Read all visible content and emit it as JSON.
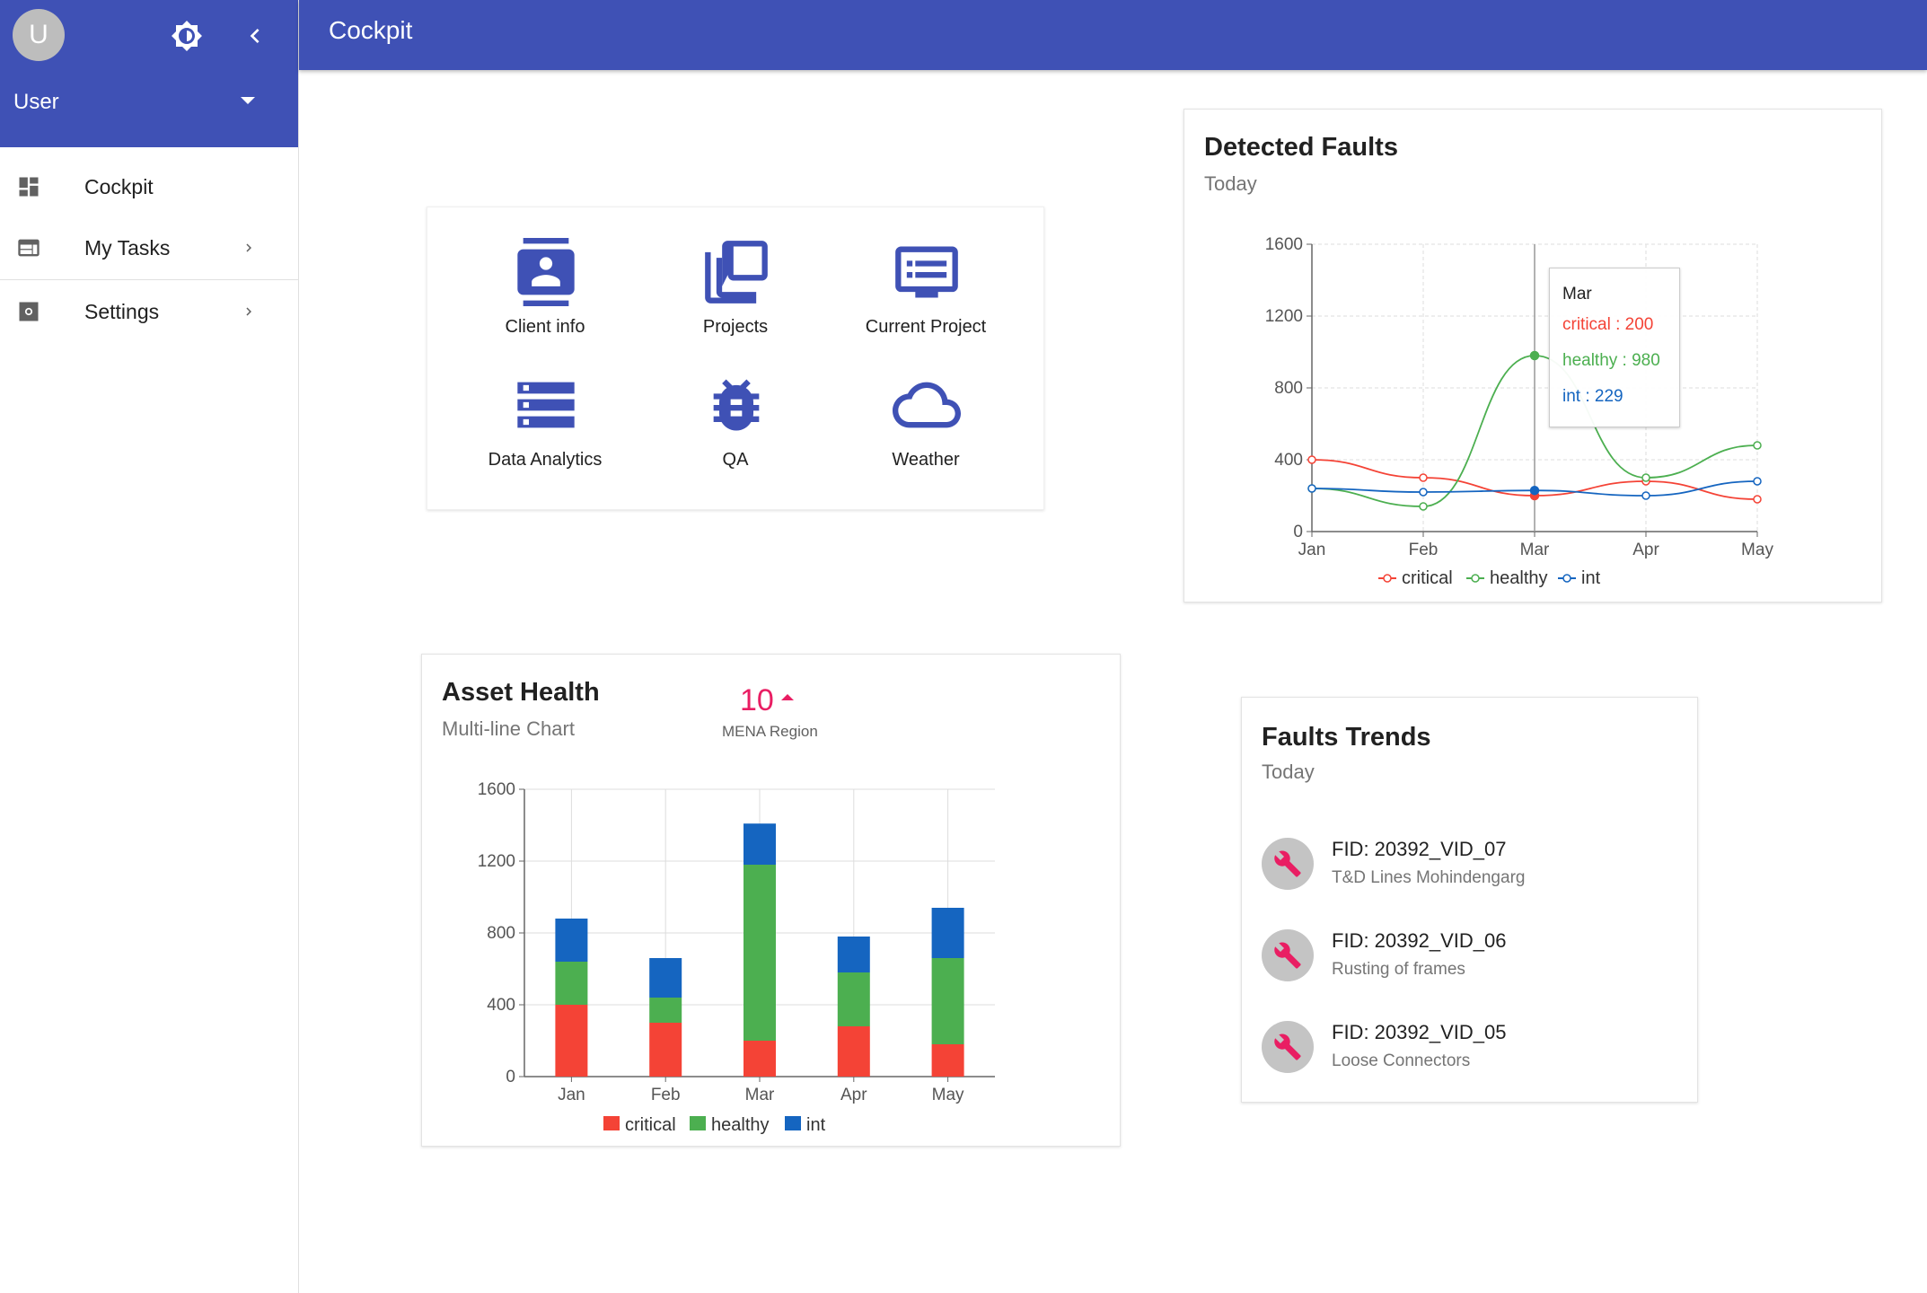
{
  "sidebar": {
    "avatar_letter": "U",
    "user_name": "User",
    "items": [
      {
        "label": "Cockpit",
        "icon": "dashboard-icon"
      },
      {
        "label": "My Tasks",
        "icon": "web-icon"
      },
      {
        "label": "Settings",
        "icon": "settings-icon"
      }
    ]
  },
  "appbar": {
    "title": "Cockpit"
  },
  "launcher": {
    "tiles": [
      {
        "label": "Client info",
        "icon": "contact-card-icon"
      },
      {
        "label": "Projects",
        "icon": "collections-icon"
      },
      {
        "label": "Current Project",
        "icon": "monitor-list-icon"
      },
      {
        "label": "Data Analytics",
        "icon": "storage-icon"
      },
      {
        "label": "QA",
        "icon": "bug-icon"
      },
      {
        "label": "Weather",
        "icon": "cloud-icon"
      }
    ]
  },
  "detected_faults": {
    "title": "Detected Faults",
    "subtitle": "Today",
    "tooltip": {
      "month": "Mar",
      "critical": "critical : 200",
      "healthy": "healthy : 980",
      "int": "int : 229"
    }
  },
  "asset_health": {
    "title": "Asset Health",
    "subtitle": "Multi-line Chart",
    "kpi_value": "10",
    "kpi_label": "MENA Region"
  },
  "faults_trends": {
    "title": "Faults Trends",
    "subtitle": "Today",
    "items": [
      {
        "id": "FID: 20392_VID_07",
        "desc": "T&D Lines Mohindengarg"
      },
      {
        "id": "FID: 20392_VID_06",
        "desc": "Rusting of frames"
      },
      {
        "id": "FID: 20392_VID_05",
        "desc": "Loose Connectors"
      }
    ]
  },
  "colors": {
    "primary": "#3f51b5",
    "critical": "#f44336",
    "healthy": "#4caf50",
    "int": "#1565c0",
    "accent": "#e91e63"
  },
  "chart_data": [
    {
      "type": "line",
      "categories": [
        "Jan",
        "Feb",
        "Mar",
        "Apr",
        "May"
      ],
      "ylim": [
        0,
        1600
      ],
      "yticks": [
        0,
        400,
        800,
        1200,
        1600
      ],
      "grid": true,
      "legend": "bottom",
      "series": [
        {
          "name": "critical",
          "color": "#f44336",
          "values": [
            400,
            300,
            200,
            280,
            180
          ]
        },
        {
          "name": "healthy",
          "color": "#4caf50",
          "values": [
            240,
            140,
            980,
            300,
            480
          ]
        },
        {
          "name": "int",
          "color": "#1565c0",
          "values": [
            240,
            220,
            229,
            200,
            280
          ]
        }
      ]
    },
    {
      "type": "bar",
      "stacked": true,
      "categories": [
        "Jan",
        "Feb",
        "Mar",
        "Apr",
        "May"
      ],
      "ylim": [
        0,
        1600
      ],
      "yticks": [
        0,
        400,
        800,
        1200,
        1600
      ],
      "grid": true,
      "legend": "bottom",
      "series": [
        {
          "name": "critical",
          "color": "#f44336",
          "values": [
            400,
            300,
            200,
            280,
            180
          ]
        },
        {
          "name": "healthy",
          "color": "#4caf50",
          "values": [
            240,
            140,
            980,
            300,
            480
          ]
        },
        {
          "name": "int",
          "color": "#1565c0",
          "values": [
            240,
            220,
            229,
            200,
            280
          ]
        }
      ]
    }
  ]
}
